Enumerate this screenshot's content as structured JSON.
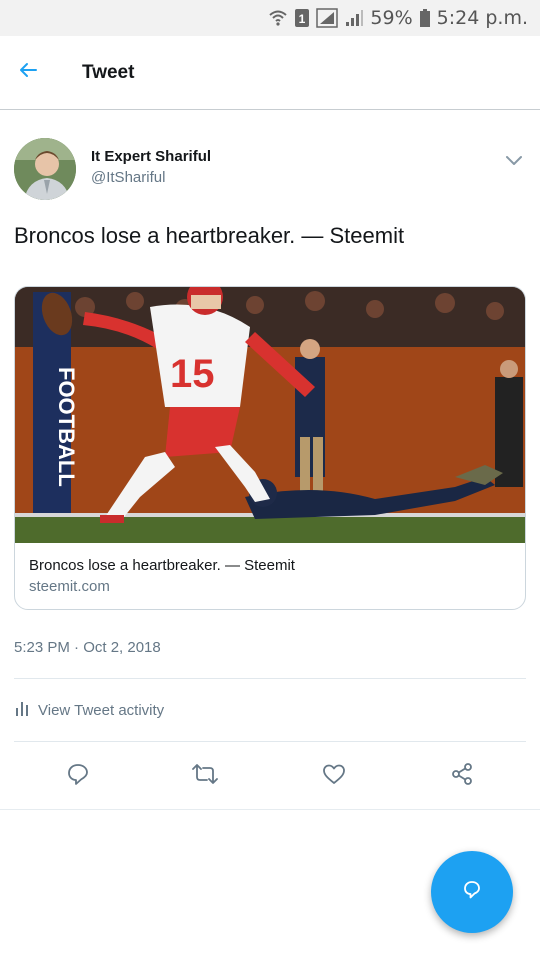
{
  "status_bar": {
    "battery_text": "59%",
    "time_text": "5:24 p.m.",
    "sim_label": "1",
    "icons": [
      "wifi-icon",
      "sim-icon",
      "signal-icon",
      "signal-icon",
      "battery-icon"
    ]
  },
  "header": {
    "title": "Tweet",
    "back_icon": "arrow-left-icon"
  },
  "tweet": {
    "author_name": "It Expert Shariful",
    "author_handle": "@ItShariful",
    "text": "Broncos lose a heartbreaker. — Steemit",
    "card": {
      "title": "Broncos lose a heartbreaker. — Steemit",
      "domain": "steemit.com",
      "image_description_icon": "football-photo",
      "jersey_number": "15",
      "banner_text": "FOOTBALL"
    },
    "timestamp": "5:23 PM · Oct 2, 2018",
    "activity_label": "View Tweet activity"
  },
  "actions": {
    "icons": [
      "reply-icon",
      "retweet-icon",
      "like-icon",
      "share-icon"
    ]
  },
  "fab": {
    "icon": "compose-reply-icon"
  },
  "colors": {
    "accent": "#1da1f2",
    "text": "#14171a",
    "secondary_text": "#657786",
    "divider": "#e1e8ed"
  }
}
